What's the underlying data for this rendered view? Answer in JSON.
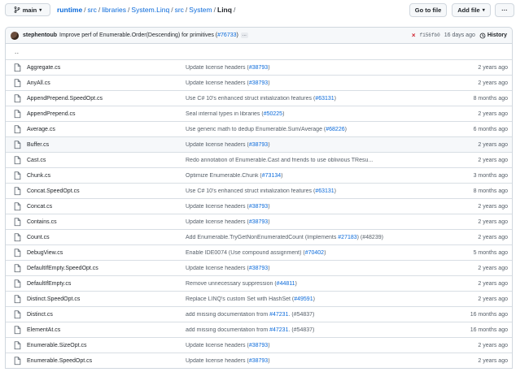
{
  "branch": {
    "name": "main"
  },
  "breadcrumb": {
    "repo": "runtime",
    "parts": [
      "src",
      "libraries",
      "System.Linq",
      "src",
      "System"
    ],
    "current": "Linq",
    "trailing": "/"
  },
  "buttons": {
    "go_to_file": "Go to file",
    "add_file": "Add file",
    "more": "···"
  },
  "commit": {
    "author": "stephentoub",
    "message": "Improve perf of Enumerable.Order(Descending) for primitives (",
    "pr": "#76733",
    "message_end": ")",
    "ellipsis": "...",
    "status": "×",
    "sha": "f156fb0",
    "time": "16 days ago",
    "history": "History"
  },
  "parent_dir": "..",
  "files": [
    {
      "name": "Aggregate.cs",
      "msg": "Update license headers (",
      "link": "#38793",
      "msg_end": ")",
      "date": "2 years ago"
    },
    {
      "name": "AnyAll.cs",
      "msg": "Update license headers (",
      "link": "#38793",
      "msg_end": ")",
      "date": "2 years ago"
    },
    {
      "name": "AppendPrepend.SpeedOpt.cs",
      "msg": "Use C# 10's enhanced struct initialization features (",
      "link": "#63131",
      "msg_end": ")",
      "date": "8 months ago"
    },
    {
      "name": "AppendPrepend.cs",
      "msg": "Seal internal types in libraries (",
      "link": "#50225",
      "msg_end": ")",
      "date": "2 years ago"
    },
    {
      "name": "Average.cs",
      "msg": "Use generic math to dedup Enumerable.Sum/Average (",
      "link": "#68226",
      "msg_end": ")",
      "date": "6 months ago"
    },
    {
      "name": "Buffer.cs",
      "msg": "Update license headers (",
      "link": "#38793",
      "msg_end": ")",
      "date": "2 years ago"
    },
    {
      "name": "Cast.cs",
      "msg": "Redo annotation of Enumerable.Cast and friends to use oblivious TResu...",
      "link": "",
      "msg_end": "",
      "date": "2 years ago"
    },
    {
      "name": "Chunk.cs",
      "msg": "Optimize Enumerable.Chunk (",
      "link": "#73134",
      "msg_end": ")",
      "date": "3 months ago"
    },
    {
      "name": "Concat.SpeedOpt.cs",
      "msg": "Use C# 10's enhanced struct initialization features (",
      "link": "#63131",
      "msg_end": ")",
      "date": "8 months ago"
    },
    {
      "name": "Concat.cs",
      "msg": "Update license headers (",
      "link": "#38793",
      "msg_end": ")",
      "date": "2 years ago"
    },
    {
      "name": "Contains.cs",
      "msg": "Update license headers (",
      "link": "#38793",
      "msg_end": ")",
      "date": "2 years ago"
    },
    {
      "name": "Count.cs",
      "msg": "Add Enumerable.TryGetNonEnumeratedCount (Implements ",
      "link": "#27183",
      "msg_end": ") (#48239)",
      "date": "2 years ago"
    },
    {
      "name": "DebugView.cs",
      "msg": "Enable IDE0074 (Use compound assignment) (",
      "link": "#70402",
      "msg_end": ")",
      "date": "5 months ago"
    },
    {
      "name": "DefaultIfEmpty.SpeedOpt.cs",
      "msg": "Update license headers (",
      "link": "#38793",
      "msg_end": ")",
      "date": "2 years ago"
    },
    {
      "name": "DefaultIfEmpty.cs",
      "msg": "Remove unnecessary suppression (",
      "link": "#44811",
      "msg_end": ")",
      "date": "2 years ago"
    },
    {
      "name": "Distinct.SpeedOpt.cs",
      "msg": "Replace LINQ's custom Set with HashSet (",
      "link": "#49591",
      "msg_end": ")",
      "date": "2 years ago"
    },
    {
      "name": "Distinct.cs",
      "msg": "add missing documentation from ",
      "link": "#47231",
      "msg_end": ". (#54837)",
      "date": "16 months ago"
    },
    {
      "name": "ElementAt.cs",
      "msg": "add missing documentation from ",
      "link": "#47231",
      "msg_end": ". (#54837)",
      "date": "16 months ago"
    },
    {
      "name": "Enumerable.SizeOpt.cs",
      "msg": "Update license headers (",
      "link": "#38793",
      "msg_end": ")",
      "date": "2 years ago"
    },
    {
      "name": "Enumerable.SpeedOpt.cs",
      "msg": "Update license headers (",
      "link": "#38793",
      "msg_end": ")",
      "date": "2 years ago"
    }
  ],
  "colors": {
    "link": "#0969da",
    "border": "#d0d7de",
    "muted": "#57606a",
    "error": "#cf222e"
  }
}
